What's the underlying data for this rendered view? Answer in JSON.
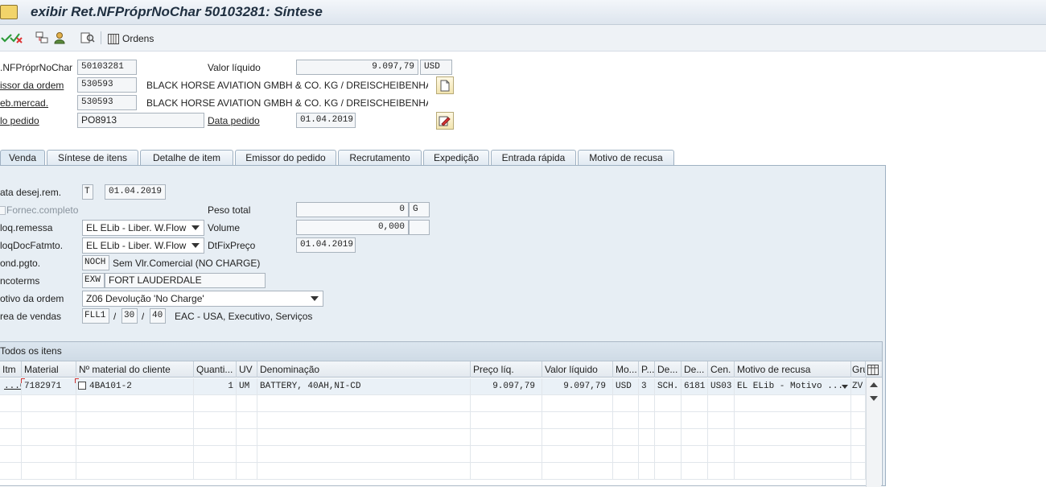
{
  "window": {
    "title": "exibir Ret.NFPróprNoChar 50103281: Síntese"
  },
  "toolbar": {
    "icons": [
      "check-icon",
      "cancel-check-icon",
      "document-flow-icon",
      "person-icon",
      "display-document-icon"
    ],
    "ordens_label": "Ordens"
  },
  "header": {
    "doc_label": ".NFPróprNoChar",
    "doc_number": "50103281",
    "net_value_label": "Valor líquido",
    "net_value": "9.097,79",
    "currency": "USD",
    "sold_to_label": "issor da ordem",
    "sold_to_number": "530593",
    "sold_to_name": "BLACK HORSE AVIATION GMBH & CO. KG / DREISCHEIBENHA...",
    "ship_to_label": "eb.mercad.",
    "ship_to_number": "530593",
    "ship_to_name": "BLACK HORSE AVIATION GMBH & CO. KG / DREISCHEIBENHA...",
    "po_label": "lo pedido",
    "po_number": "PO8913",
    "po_date_label": "Data pedido",
    "po_date": "01.04.2019"
  },
  "tabs": [
    {
      "label": "Venda",
      "active": true
    },
    {
      "label": "Síntese de itens"
    },
    {
      "label": "Detalhe de item"
    },
    {
      "label": "Emissor do pedido"
    },
    {
      "label": "Recrutamento"
    },
    {
      "label": "Expedição"
    },
    {
      "label": "Entrada rápida"
    },
    {
      "label": "Motivo de recusa"
    }
  ],
  "venda": {
    "req_date_label": "ata desej.rem.",
    "req_date_type": "T",
    "req_date": "01.04.2019",
    "complete_dlv_label": "Fornec.completo",
    "total_weight_label": "Peso total",
    "total_weight": "0",
    "weight_unit": "G",
    "delivery_block_label": "loq.remessa",
    "delivery_block": "EL ELib - Liber. W.Flow",
    "volume_label": "Volume",
    "volume": "0,000",
    "billing_block_label": "loqDocFatmto.",
    "billing_block": "EL ELib - Liber. W.Flow",
    "price_date_label": "DtFixPreço",
    "price_date": "01.04.2019",
    "payment_terms_label": "ond.pgto.",
    "payment_terms_code": "NOCH",
    "payment_terms_text": "Sem Vlr.Comercial (NO CHARGE)",
    "incoterms_label": "ncoterms",
    "incoterms_code": "EXW",
    "incoterms_place": "FORT LAUDERDALE",
    "order_reason_label": "otivo da ordem",
    "order_reason": "Z06 Devolução 'No Charge'",
    "sales_area_label": "rea de vendas",
    "sales_org": "FLL1",
    "distr_channel": "30",
    "division": "40",
    "sales_area_separator": "/",
    "sales_area_text": "EAC - USA, Executivo, Serviços"
  },
  "items_table": {
    "title": "Todos os itens",
    "columns": [
      "Itm",
      "Material",
      "Nº material do cliente",
      "Quanti...",
      "UV",
      "Denominação",
      "Preço líq.",
      "Valor líquido",
      "Mo...",
      "P...",
      "De...",
      "De...",
      "Cen.",
      "Motivo de recusa",
      "Gru"
    ],
    "rows": [
      [
        "...00",
        "7182971",
        "4BA101-2",
        "1",
        "UM",
        "BATTERY, 40AH,NI-CD",
        "9.097,79",
        "9.097,79",
        "USD",
        "3",
        "SCH...",
        "6181",
        "US03",
        "EL ELib - Motivo ...",
        "ZV"
      ]
    ]
  },
  "colors": {
    "panel_bg": "#e7eef4",
    "title_text": "#1f2f40",
    "border": "#9fb1c2"
  }
}
